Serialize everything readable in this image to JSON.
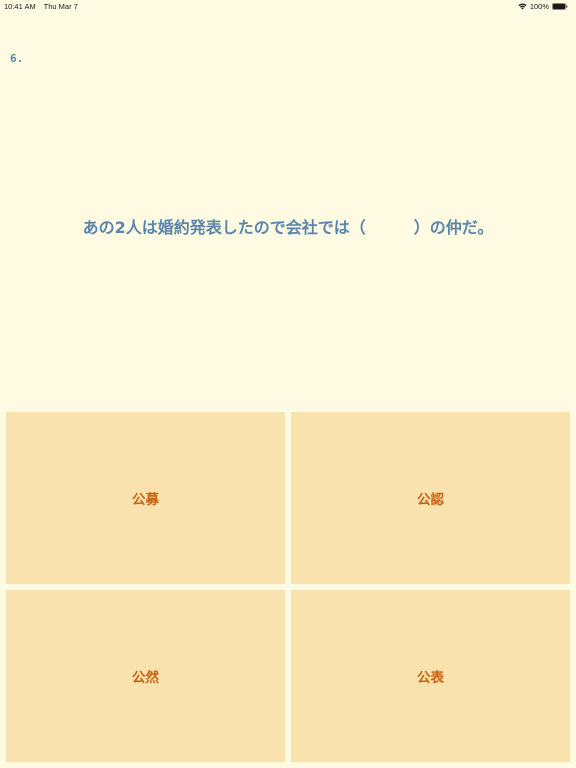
{
  "status_bar": {
    "time": "10:41 AM",
    "date": "Thu Mar 7",
    "battery": "100%",
    "icons": [
      "wifi-icon",
      "battery-icon"
    ]
  },
  "question": {
    "number": "6.",
    "text": "あの2人は婚約発表したので会社では（　　　）の仲だ。"
  },
  "answers": [
    {
      "label": "公募"
    },
    {
      "label": "公認"
    },
    {
      "label": "公然"
    },
    {
      "label": "公表"
    }
  ],
  "colors": {
    "background": "#fffbe3",
    "question_text": "#5b85ac",
    "answer_bg": "#f9e2ad",
    "answer_text": "#c9630f"
  }
}
